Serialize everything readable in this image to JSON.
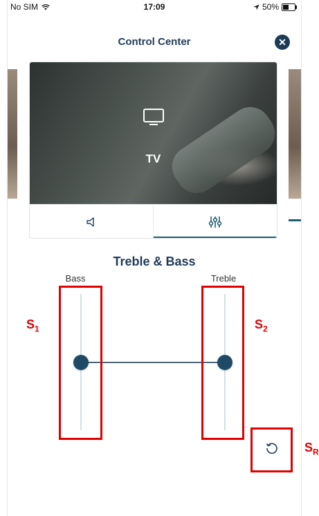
{
  "status_bar": {
    "carrier": "No SIM",
    "time": "17:09",
    "battery_percent_text": "50%",
    "battery_level": 0.5
  },
  "header": {
    "title": "Control Center"
  },
  "device_card": {
    "name": "TV",
    "icon": "tv-icon",
    "tabs": [
      {
        "icon": "speaker-icon",
        "active": false
      },
      {
        "icon": "equalizer-icon",
        "active": true
      }
    ]
  },
  "section": {
    "title": "Treble & Bass"
  },
  "sliders": {
    "bass": {
      "label": "Bass",
      "level": 0.5
    },
    "treble": {
      "label": "Treble",
      "level": 0.5
    }
  },
  "reset": {
    "icon": "reset-icon"
  },
  "annotations": {
    "s1": {
      "letter": "S",
      "sub": "1"
    },
    "s2": {
      "letter": "S",
      "sub": "2"
    },
    "sr": {
      "letter": "S",
      "sub": "R"
    }
  },
  "colors": {
    "accent": "#1f5c73",
    "knob": "#1f4a66",
    "annotation": "#e00000"
  }
}
